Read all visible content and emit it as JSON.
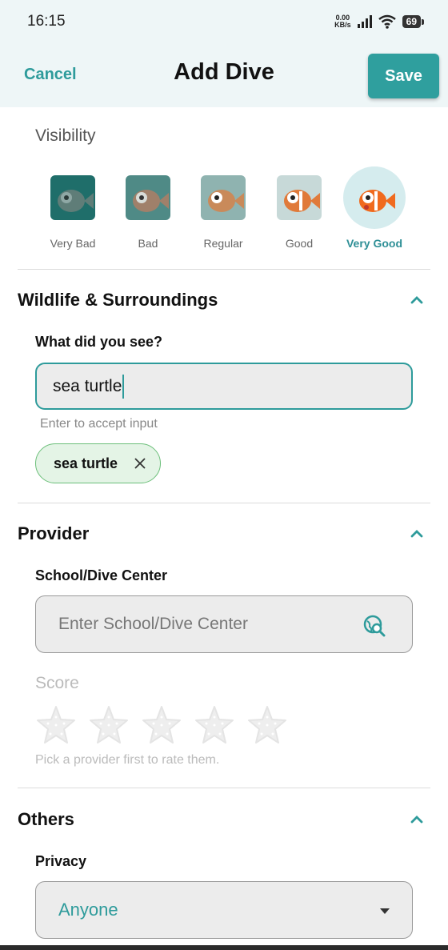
{
  "status_bar": {
    "time": "16:15",
    "net_speed_value": "0.00",
    "net_speed_unit": "KB/s",
    "battery": "69"
  },
  "header": {
    "cancel_label": "Cancel",
    "title": "Add Dive",
    "save_label": "Save"
  },
  "visibility": {
    "label": "Visibility",
    "selected": "Very Good",
    "options": [
      {
        "label": "Very Bad",
        "tint": "#1f6e6a"
      },
      {
        "label": "Bad",
        "tint": "#4f8a86"
      },
      {
        "label": "Regular",
        "tint": "#8fb3b0"
      },
      {
        "label": "Good",
        "tint": "#c7d9d8"
      },
      {
        "label": "Very Good",
        "tint": "#d5ecee"
      }
    ]
  },
  "wildlife": {
    "section_title": "Wildlife & Surroundings",
    "question": "What did you see?",
    "input_value": "sea turtle",
    "helper": "Enter to accept input",
    "chips": [
      "sea turtle"
    ]
  },
  "provider": {
    "section_title": "Provider",
    "school_label": "School/Dive Center",
    "school_placeholder": "Enter School/Dive Center",
    "score_label": "Score",
    "score_value": 0,
    "score_max": 5,
    "score_hint": "Pick a provider first to rate them."
  },
  "others": {
    "section_title": "Others",
    "privacy_label": "Privacy",
    "privacy_value": "Anyone"
  },
  "colors": {
    "accent": "#2e9b9b",
    "header_bg": "#eef6f7",
    "chip_bg": "#e4f4e6",
    "chip_border": "#6cbf7a"
  }
}
